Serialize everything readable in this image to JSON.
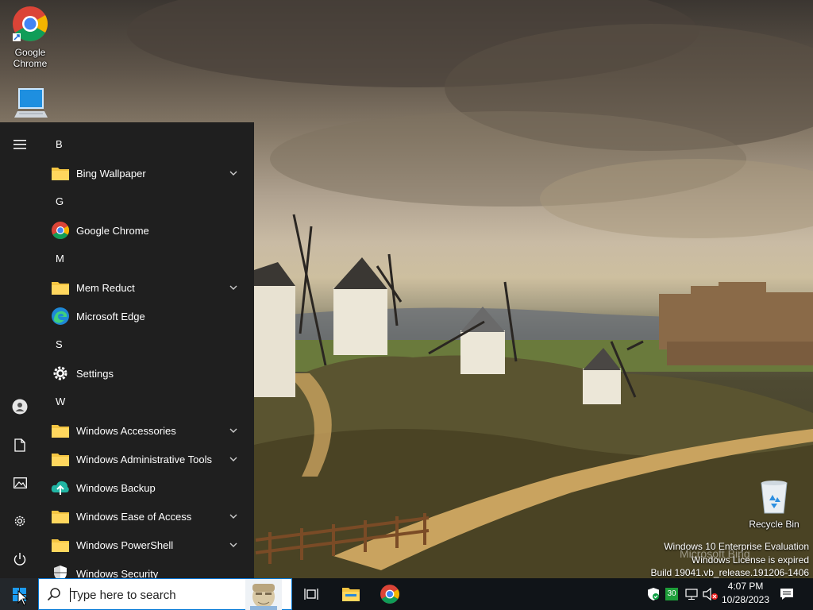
{
  "desktop": {
    "icons": [
      {
        "label_line1": "Google",
        "label_line2": "Chrome",
        "icon": "chrome-icon"
      },
      {
        "label": "",
        "icon": "this-pc-icon"
      },
      {
        "label": "Recycle Bin",
        "icon": "recycle-bin-icon"
      }
    ],
    "watermark": {
      "line1": "Windows 10 Enterprise Evaluation",
      "line2": "Windows License is expired",
      "line3": "Build 19041.vb_release.191206-1406"
    },
    "bing_watermark": "Microsoft Bing"
  },
  "start_menu": {
    "rail": [
      {
        "name": "expand",
        "icon": "hamburger-icon"
      },
      {
        "name": "account",
        "icon": "user-icon"
      },
      {
        "name": "documents",
        "icon": "document-icon"
      },
      {
        "name": "pictures",
        "icon": "pictures-icon"
      },
      {
        "name": "settings",
        "icon": "gear-icon"
      },
      {
        "name": "power",
        "icon": "power-icon"
      }
    ],
    "groups": [
      {
        "letter": "B",
        "apps": [
          {
            "label": "Bing Wallpaper",
            "icon": "folder-icon",
            "expandable": true
          }
        ]
      },
      {
        "letter": "G",
        "apps": [
          {
            "label": "Google Chrome",
            "icon": "chrome-icon",
            "expandable": false
          }
        ]
      },
      {
        "letter": "M",
        "apps": [
          {
            "label": "Mem Reduct",
            "icon": "folder-icon",
            "expandable": true
          },
          {
            "label": "Microsoft Edge",
            "icon": "edge-icon",
            "expandable": false
          }
        ]
      },
      {
        "letter": "S",
        "apps": [
          {
            "label": "Settings",
            "icon": "gear-icon",
            "expandable": false
          }
        ]
      },
      {
        "letter": "W",
        "apps": [
          {
            "label": "Windows Accessories",
            "icon": "folder-icon",
            "expandable": true
          },
          {
            "label": "Windows Administrative Tools",
            "icon": "folder-icon",
            "expandable": true
          },
          {
            "label": "Windows Backup",
            "icon": "backup-icon",
            "expandable": false
          },
          {
            "label": "Windows Ease of Access",
            "icon": "folder-icon",
            "expandable": true
          },
          {
            "label": "Windows PowerShell",
            "icon": "folder-icon",
            "expandable": true
          },
          {
            "label": "Windows Security",
            "icon": "shield-icon",
            "expandable": false
          }
        ]
      }
    ]
  },
  "taskbar": {
    "search_placeholder": "Type here to search",
    "pinned": [
      {
        "name": "task-view",
        "icon": "task-view-icon"
      },
      {
        "name": "file-explorer",
        "icon": "file-explorer-icon"
      },
      {
        "name": "chrome",
        "icon": "chrome-icon"
      }
    ],
    "tray": {
      "security_icon": "shield-check-icon",
      "badge_number": "30",
      "network_icon": "network-icon",
      "volume_icon": "volume-muted-icon",
      "notification_icon": "action-center-icon"
    },
    "clock": {
      "time": "4:07 PM",
      "date": "10/28/2023"
    }
  },
  "colors": {
    "start_bg": "#1f1f1f",
    "taskbar_bg": "#101418",
    "accent": "#0078d7",
    "folder": "#f4c542"
  }
}
